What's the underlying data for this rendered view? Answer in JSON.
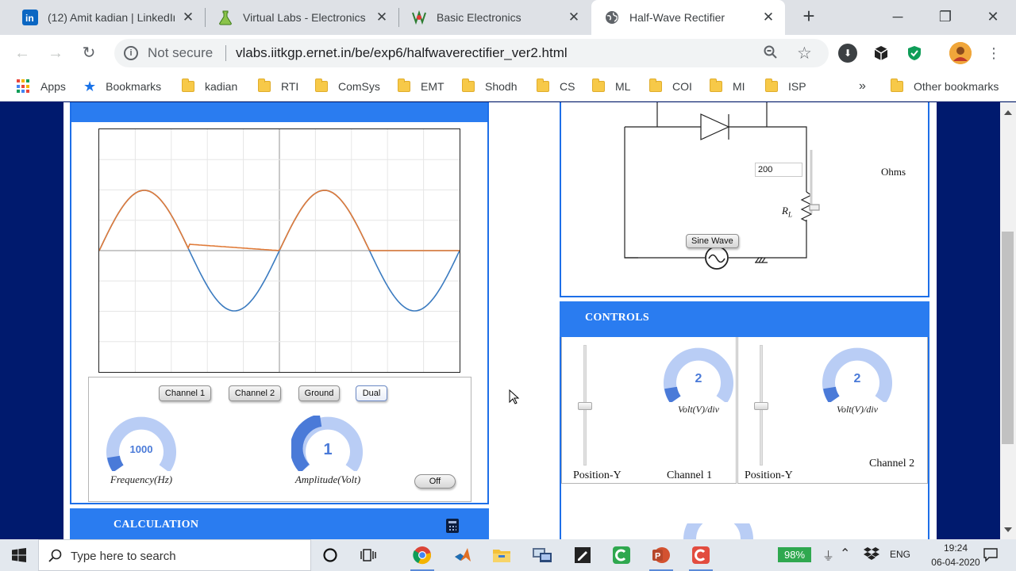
{
  "browser": {
    "tabs": [
      {
        "label": "(12) Amit kadian | LinkedIn",
        "icon": "linkedin-icon",
        "active": false
      },
      {
        "label": "Virtual Labs - Electronics",
        "icon": "flask-icon",
        "active": false
      },
      {
        "label": "Basic Electronics",
        "icon": "vlabs-icon",
        "active": false
      },
      {
        "label": "Half-Wave Rectifier",
        "icon": "globe-icon",
        "active": true
      }
    ],
    "security_label": "Not secure",
    "url": "vlabs.iitkgp.ernet.in/be/exp6/halfwaverectifier_ver2.html",
    "bookmarks": [
      "Apps",
      "Bookmarks",
      "kadian",
      "RTI",
      "ComSys",
      "EMT",
      "Shodh",
      "CS",
      "ML",
      "COI",
      "MI",
      "ISP"
    ],
    "overflow_label": "»",
    "other_bookmarks": "Other bookmarks"
  },
  "oscilloscope": {
    "channel_buttons": [
      "Channel 1",
      "Channel 2",
      "Ground",
      "Dual"
    ],
    "selected_mode": "Dual",
    "frequency": {
      "value": "1000",
      "label": "Frequency(Hz)"
    },
    "amplitude": {
      "value": "1",
      "label": "Amplitude(Volt)"
    },
    "power_button": "Off",
    "trace_colors": {
      "input": "#3b7bc0",
      "output": "#e07b39"
    }
  },
  "calculation": {
    "title": "CALCULATION"
  },
  "circuit": {
    "load_resistance": "200",
    "load_unit": "Ohms",
    "load_label": "R",
    "load_subscript": "L",
    "source_button": "Sine Wave"
  },
  "controls": {
    "title": "CONTROLS",
    "channel1": {
      "volt_div": "2",
      "unit": "Volt(V)/div",
      "position_label": "Position-Y",
      "channel_label": "Channel 1"
    },
    "channel2": {
      "volt_div": "2",
      "unit": "Volt(V)/div",
      "position_label": "Position-Y",
      "channel_label": "Channel 2"
    }
  },
  "taskbar": {
    "search_placeholder": "Type here to search",
    "battery": "98%",
    "language": "ENG",
    "time": "19:24",
    "date": "06-04-2020"
  },
  "colors": {
    "panel_blue": "#2a7cf0",
    "page_bg": "#001a6e",
    "knob_blue": "#4a7ad8"
  }
}
